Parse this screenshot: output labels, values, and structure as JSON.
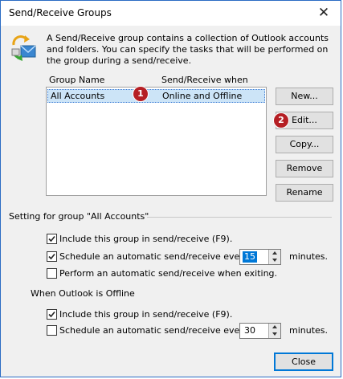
{
  "window": {
    "title": "Send/Receive Groups",
    "close_glyph": "✕"
  },
  "description": "A Send/Receive group contains a collection of Outlook accounts and folders. You can specify the tasks that will be performed on the group during a send/receive.",
  "groups_list": {
    "col_group_name": "Group Name",
    "col_send_receive_when": "Send/Receive when",
    "rows": [
      {
        "name": "All Accounts",
        "when": "Online and Offline"
      }
    ]
  },
  "buttons": {
    "new": "New...",
    "edit": "Edit...",
    "copy": "Copy...",
    "remove": "Remove",
    "rename": "Rename",
    "close": "Close"
  },
  "callouts": {
    "one": "1",
    "two": "2"
  },
  "setting_section": {
    "title": "Setting for group \"All Accounts\"",
    "include": {
      "label": "Include this group in send/receive (F9).",
      "checked": true
    },
    "schedule": {
      "label": "Schedule an automatic send/receive every",
      "checked": true,
      "minutes": "15",
      "unit": "minutes."
    },
    "exit": {
      "label": "Perform an automatic send/receive when exiting.",
      "checked": false
    }
  },
  "offline_section": {
    "title": "When Outlook is Offline",
    "include": {
      "label": "Include this group in send/receive (F9).",
      "checked": true
    },
    "schedule": {
      "label": "Schedule an automatic send/receive every",
      "checked": false,
      "minutes": "30",
      "unit": "minutes."
    }
  },
  "colors": {
    "accent": "#0078d7",
    "callout": "#b51f24",
    "selection": "#cce4f7"
  }
}
